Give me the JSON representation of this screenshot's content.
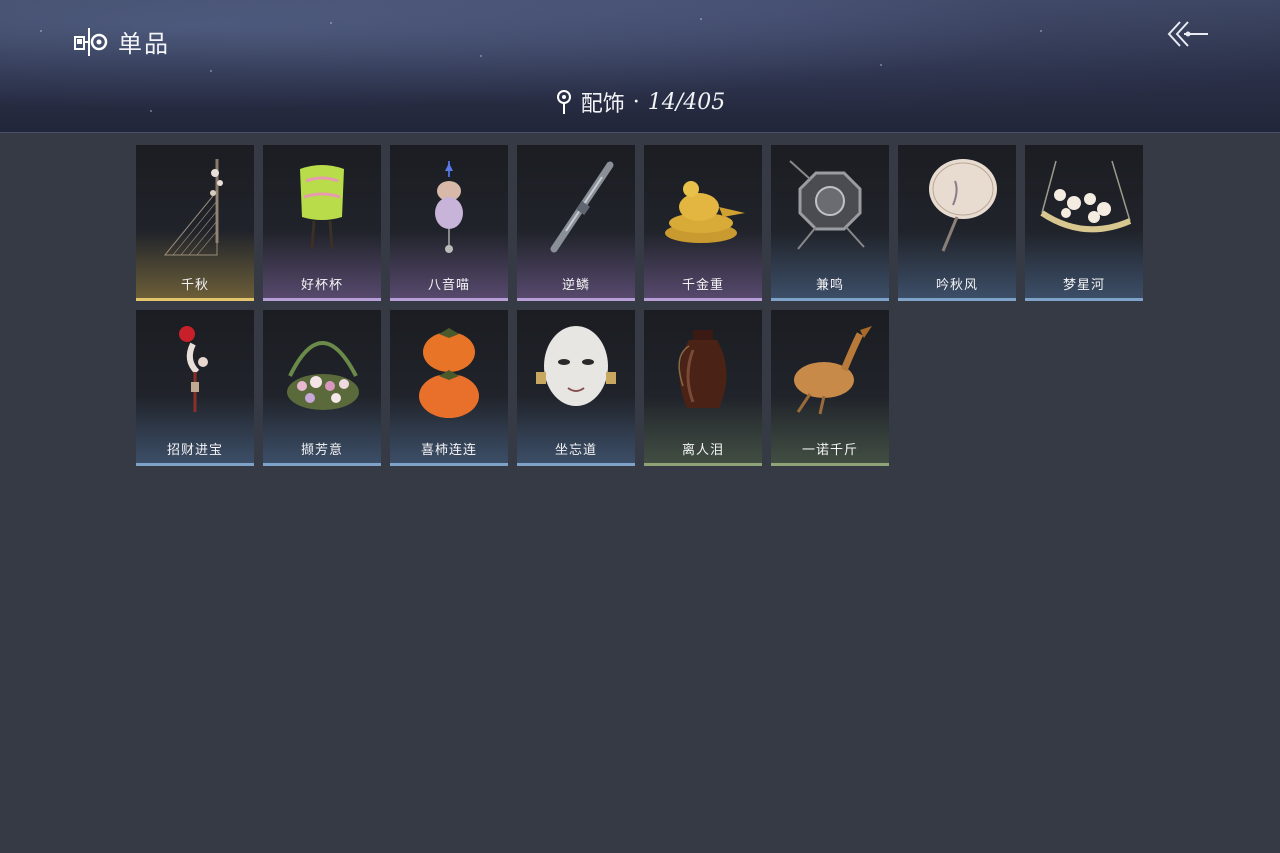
{
  "header": {
    "title": "单品",
    "back_icon": "back-arrow-icon",
    "title_icon": "outfit-icon"
  },
  "category": {
    "icon": "pin-icon",
    "name": "配饰",
    "separator": "·",
    "count": "14/405"
  },
  "items": [
    {
      "name": "千秋",
      "tier": "gold",
      "art": "string-instrument"
    },
    {
      "name": "好杯杯",
      "tier": "purple",
      "art": "green-cup"
    },
    {
      "name": "八音喵",
      "tier": "purple",
      "art": "cat-pendant"
    },
    {
      "name": "逆鳞",
      "tier": "purple",
      "art": "blade"
    },
    {
      "name": "千金重",
      "tier": "purple",
      "art": "golden-bird"
    },
    {
      "name": "兼鸣",
      "tier": "blue",
      "art": "octagon-charm"
    },
    {
      "name": "吟秋风",
      "tier": "blue",
      "art": "round-fan"
    },
    {
      "name": "梦星河",
      "tier": "blue",
      "art": "flower-swing"
    },
    {
      "name": "招财进宝",
      "tier": "blue",
      "art": "red-tassel"
    },
    {
      "name": "撷芳意",
      "tier": "blue",
      "art": "flower-basket"
    },
    {
      "name": "喜柿连连",
      "tier": "blue",
      "art": "persimmons"
    },
    {
      "name": "坐忘道",
      "tier": "blue",
      "art": "white-mask"
    },
    {
      "name": "离人泪",
      "tier": "green",
      "art": "wine-jar"
    },
    {
      "name": "一诺千斤",
      "tier": "green",
      "art": "roast-duck"
    }
  ]
}
